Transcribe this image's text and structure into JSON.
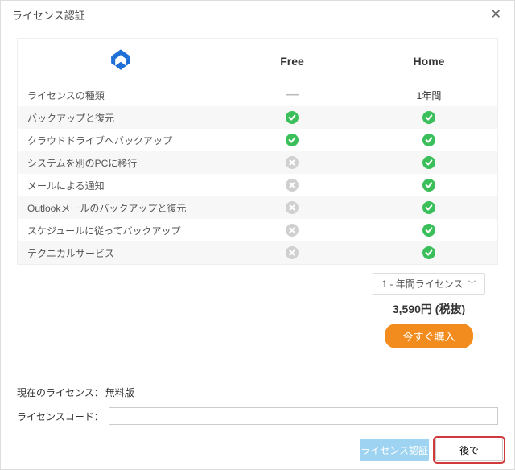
{
  "window": {
    "title": "ライセンス認証"
  },
  "table": {
    "free_header": "Free",
    "home_header": "Home",
    "rows": [
      {
        "label": "ライセンスの種類",
        "free": "dash",
        "home_text": "1年間",
        "alt": false
      },
      {
        "label": "バックアップと復元",
        "free": "check",
        "home": "check",
        "alt": true
      },
      {
        "label": "クラウドドライブへバックアップ",
        "free": "check",
        "home": "check",
        "alt": false
      },
      {
        "label": "システムを別のPCに移行",
        "free": "cross",
        "home": "check",
        "alt": true
      },
      {
        "label": "メールによる通知",
        "free": "cross",
        "home": "check",
        "alt": false
      },
      {
        "label": "Outlookメールのバックアップと復元",
        "free": "cross",
        "home": "check",
        "alt": true
      },
      {
        "label": "スケジュールに従ってバックアップ",
        "free": "cross",
        "home": "check",
        "alt": false
      },
      {
        "label": "テクニカルサービス",
        "free": "cross",
        "home": "check",
        "alt": true
      }
    ]
  },
  "pricing": {
    "dropdown": "1 - 年間ライセンス",
    "price": "3,590円 (税抜)",
    "buy": "今すぐ購入"
  },
  "current_license": {
    "label": "現在のライセンス：",
    "value": "無料版"
  },
  "code": {
    "label": "ライセンスコード：",
    "value": ""
  },
  "footer": {
    "activate": "ライセンス認証",
    "later": "後で"
  }
}
